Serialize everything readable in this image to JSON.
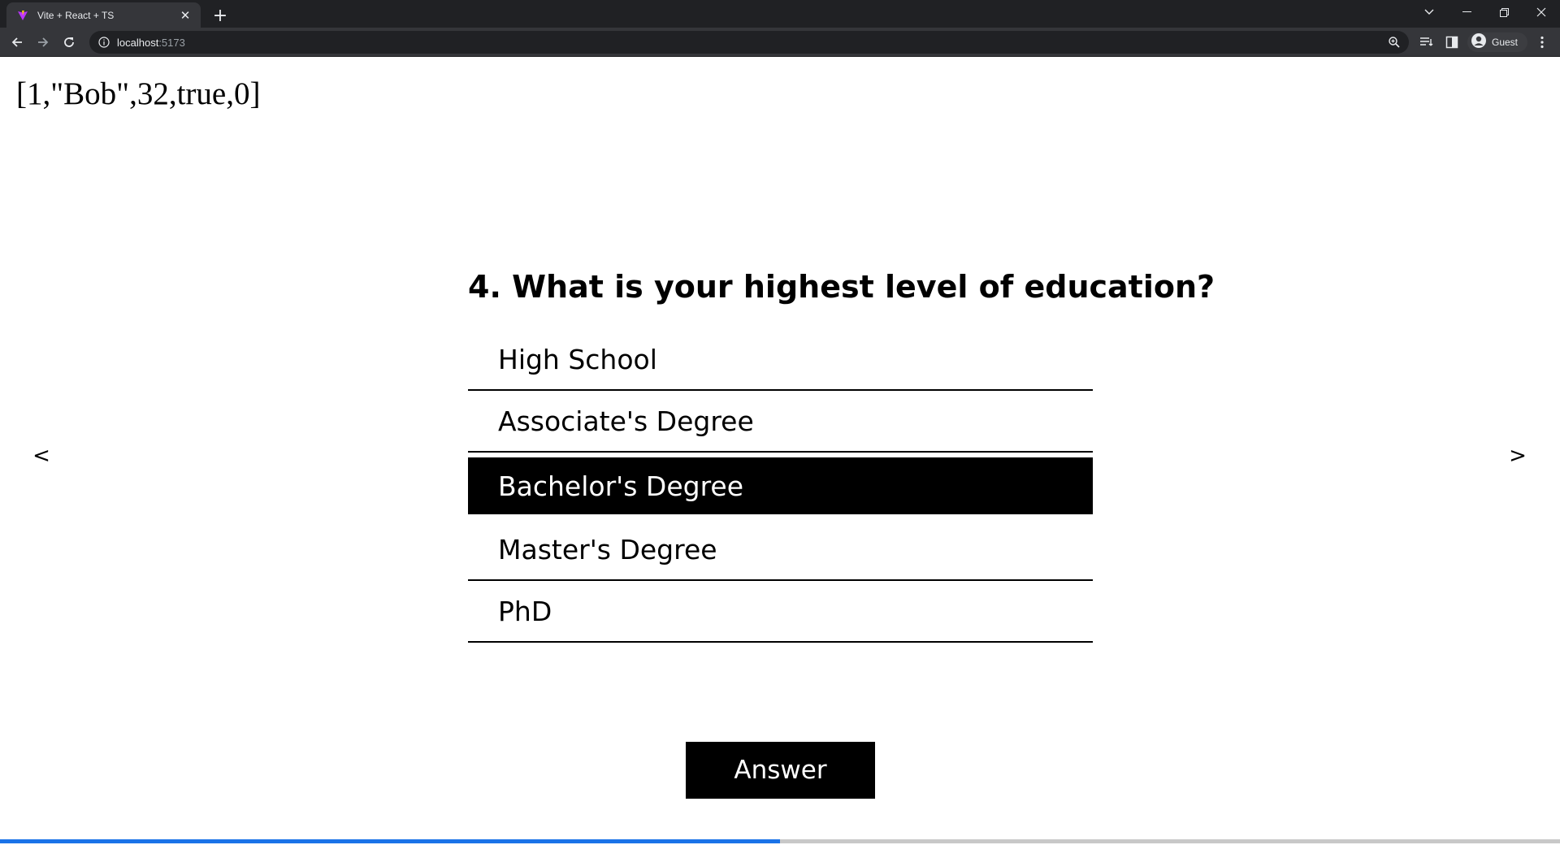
{
  "browser": {
    "tab_title": "Vite + React + TS",
    "url_host": "localhost",
    "url_port": ":5173",
    "profile_label": "Guest"
  },
  "page": {
    "state_dump": "[1,\"Bob\",32,true,0]",
    "prev_arrow": "<",
    "next_arrow": ">",
    "question": "4. What is your highest level of education?",
    "options": [
      {
        "label": "High School",
        "selected": false
      },
      {
        "label": "Associate's Degree",
        "selected": false
      },
      {
        "label": "Bachelor's Degree",
        "selected": true
      },
      {
        "label": "Master's Degree",
        "selected": false
      },
      {
        "label": "PhD",
        "selected": false
      }
    ],
    "answer_label": "Answer",
    "progress_fraction": 0.5
  },
  "colors": {
    "accent": "#1a73e8",
    "selected_bg": "#000000",
    "selected_fg": "#ffffff"
  }
}
